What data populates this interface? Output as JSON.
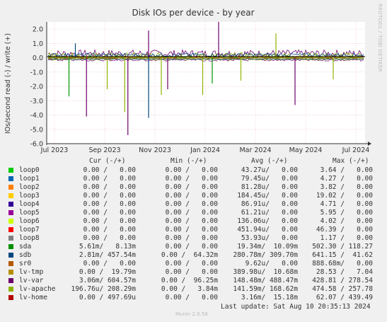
{
  "chart_data": {
    "type": "line",
    "title": "Disk IOs per device - by year",
    "ylabel": "IOs/second read (-) / write (+)",
    "ylim": [
      -6.0,
      2.5
    ],
    "yticks": [
      "2.0",
      "1.0",
      "0.0",
      "-1.0",
      "-2.0",
      "-3.0",
      "-4.0",
      "-5.0",
      "-6.0"
    ],
    "ytick_values": [
      2,
      1,
      0,
      -1,
      -2,
      -3,
      -4,
      -5,
      -6
    ],
    "xticks": [
      "Jul 2023",
      "Sep 2023",
      "Nov 2023",
      "Jan 2024",
      "Mar 2024",
      "May 2024",
      "Jul 2024"
    ],
    "grid": true,
    "spikes": [
      {
        "series": "sda",
        "x": 0.07,
        "y": -2.7
      },
      {
        "series": "lv-var",
        "x": 0.125,
        "y": -4.1
      },
      {
        "series": "lv-apache",
        "x": 0.19,
        "y": -2.2
      },
      {
        "series": "lv-var",
        "x": 0.255,
        "y": -5.4
      },
      {
        "series": "lv-apache",
        "x": 0.245,
        "y": -3.8
      },
      {
        "series": "sdb",
        "x": 0.32,
        "y": -4.2
      },
      {
        "series": "lv-apache",
        "x": 0.36,
        "y": -2.6
      },
      {
        "series": "lv-var",
        "x": 0.38,
        "y": -2.2
      },
      {
        "series": "sda",
        "x": 0.52,
        "y": -1.8
      },
      {
        "series": "lv-apache",
        "x": 0.49,
        "y": -2.6
      },
      {
        "series": "lv-apache",
        "x": 0.61,
        "y": -1.6
      },
      {
        "series": "lv-var",
        "x": 0.78,
        "y": -3.3
      },
      {
        "series": "lv-apache",
        "x": 0.9,
        "y": -1.5
      },
      {
        "series": "lv-var",
        "x": 0.32,
        "y": 1.9
      },
      {
        "series": "lv-var",
        "x": 0.54,
        "y": 2.5
      },
      {
        "series": "lv-apache",
        "x": 0.72,
        "y": 1.7
      },
      {
        "series": "sdb",
        "x": 0.09,
        "y": 1.0
      }
    ]
  },
  "rrdtool": "RRDTOOL / TOBI OETIKER",
  "legend": {
    "headers": {
      "cur": "Cur (-/+)",
      "min": "Min (-/+)",
      "avg": "Avg (-/+)",
      "max": "Max (-/+)"
    },
    "rows": [
      {
        "name": "loop0",
        "color": "#00cc00",
        "cur": "0.00 /   0.00",
        "min": "0.00 /   0.00",
        "avg": "43.27u/   0.00",
        "max": "3.64 /   0.00"
      },
      {
        "name": "loop1",
        "color": "#0066b3",
        "cur": "0.00 /   0.00",
        "min": "0.00 /   0.00",
        "avg": "79.45u/   0.00",
        "max": "4.27 /   0.00"
      },
      {
        "name": "loop2",
        "color": "#ff8000",
        "cur": "0.00 /   0.00",
        "min": "0.00 /   0.00",
        "avg": "81.28u/   0.00",
        "max": "3.82 /   0.00"
      },
      {
        "name": "loop3",
        "color": "#ffcc00",
        "cur": "0.00 /   0.00",
        "min": "0.00 /   0.00",
        "avg": "184.45u/   0.00",
        "max": "19.02 /   0.00"
      },
      {
        "name": "loop4",
        "color": "#330099",
        "cur": "0.00 /   0.00",
        "min": "0.00 /   0.00",
        "avg": "86.91u/   0.00",
        "max": "4.71 /   0.00"
      },
      {
        "name": "loop5",
        "color": "#990099",
        "cur": "0.00 /   0.00",
        "min": "0.00 /   0.00",
        "avg": "61.21u/   0.00",
        "max": "5.95 /   0.00"
      },
      {
        "name": "loop6",
        "color": "#ccff00",
        "cur": "0.00 /   0.00",
        "min": "0.00 /   0.00",
        "avg": "136.06u/   0.00",
        "max": "4.02 /   0.00"
      },
      {
        "name": "loop7",
        "color": "#ff0000",
        "cur": "0.00 /   0.00",
        "min": "0.00 /   0.00",
        "avg": "451.94u/   0.00",
        "max": "46.39 /   0.00"
      },
      {
        "name": "loop8",
        "color": "#808080",
        "cur": "0.00 /   0.00",
        "min": "0.00 /   0.00",
        "avg": "53.93u/   0.00",
        "max": "1.17 /   0.00"
      },
      {
        "name": "sda",
        "color": "#008f00",
        "cur": "5.61m/   8.13m",
        "min": "0.00 /   0.00",
        "avg": "19.34m/  10.09m",
        "max": "502.30 / 118.27"
      },
      {
        "name": "sdb",
        "color": "#00487d",
        "cur": "2.81m/ 457.54m",
        "min": "0.00 /  64.32m",
        "avg": "280.78m/ 309.70m",
        "max": "641.15 /  41.62"
      },
      {
        "name": "sr0",
        "color": "#b35a00",
        "cur": "0.00 /   0.00",
        "min": "0.00 /   0.00",
        "avg": "9.62u/   0.00",
        "max": "888.68m/   0.00"
      },
      {
        "name": "lv-tmp",
        "color": "#b38f00",
        "cur": "0.00 /  19.79m",
        "min": "0.00 /   0.00",
        "avg": "389.98u/  10.68m",
        "max": "28.53 /   7.04"
      },
      {
        "name": "lv-var",
        "color": "#6b006b",
        "cur": "3.06m/ 604.57m",
        "min": "0.00 /  96.25m",
        "avg": "148.48m/ 488.47m",
        "max": "428.81 / 278.54"
      },
      {
        "name": "lv-apache",
        "color": "#8fb300",
        "cur": "196.76u/ 208.29m",
        "min": "0.00 /   3.84m",
        "avg": "141.59m/ 168.62m",
        "max": "474.58 / 257.78"
      },
      {
        "name": "lv-home",
        "color": "#b30000",
        "cur": "0.00 / 497.69u",
        "min": "0.00 /   0.00",
        "avg": "3.16m/  15.18m",
        "max": "62.07 / 439.49"
      }
    ]
  },
  "footer": "Last update: Sat Aug 10 20:35:13 2024",
  "credit": "Munin 2.0.56"
}
